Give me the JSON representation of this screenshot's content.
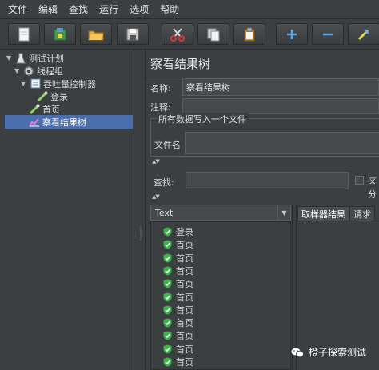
{
  "menu": [
    "文件",
    "编辑",
    "查找",
    "运行",
    "选项",
    "帮助"
  ],
  "toolbar": {
    "buttons": [
      {
        "icon": "new-document-icon"
      },
      {
        "icon": "templates-icon"
      },
      {
        "icon": "open-folder-icon"
      },
      {
        "icon": "save-icon"
      },
      {
        "icon": "cut-icon"
      },
      {
        "icon": "copy-icon"
      },
      {
        "icon": "paste-icon"
      },
      {
        "icon": "expand-plus-icon"
      },
      {
        "icon": "collapse-minus-icon"
      },
      {
        "icon": "toggle-icon"
      }
    ]
  },
  "tree": {
    "test_plan": "测试计划",
    "thread_group": "线程组",
    "throughput_controller": "吞吐量控制器",
    "login": "登录",
    "home": "首页",
    "view_results_tree": "察看结果树"
  },
  "panel": {
    "title": "察看结果树",
    "name_label": "名称:",
    "name_value": "察看结果树",
    "comment_label": "注释:",
    "comment_value": "",
    "write_all_group": "所有数据写入一个文件",
    "filename_label": "文件名",
    "filename_value": "",
    "search_label": "查找:",
    "search_value": "",
    "case_label": "区分",
    "renderer_selected": "Text",
    "tabs": [
      "取样器结果",
      "请求"
    ]
  },
  "results": [
    "登录",
    "首页",
    "首页",
    "首页",
    "首页",
    "首页",
    "首页",
    "首页",
    "首页",
    "首页",
    "首页",
    "首页"
  ],
  "watermark": "橙子探索测试",
  "colors": {
    "selection": "#4b6eaf",
    "success_shield": "#3bb54a",
    "background": "#3c3f41"
  }
}
